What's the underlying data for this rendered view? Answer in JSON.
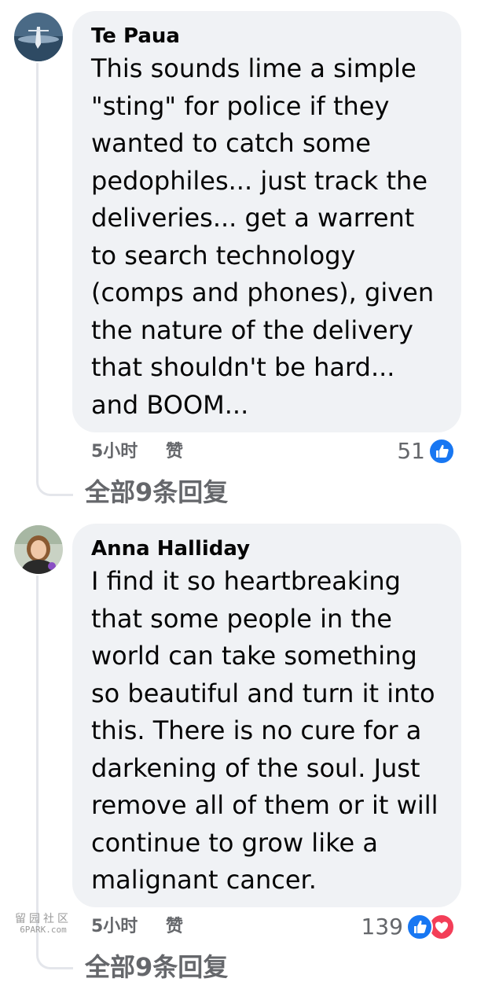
{
  "comments": [
    {
      "author": "Te Paua",
      "text": "This sounds lime a simple \"sting\" for police if they wanted to catch some pedophiles... just track the deliveries... get a warrent to search technology (comps and phones), given the nature of the delivery that shouldn't be hard... and BOOM...",
      "time": "5小时",
      "like_label": "赞",
      "reaction_count": "51",
      "reaction_icons": [
        "like-icon"
      ],
      "replies_label": "全部9条回复"
    },
    {
      "author": "Anna Halliday",
      "text": "I find it so heartbreaking that some people in the world can take something so beautiful and turn it into this. There is no cure for a darkening of the soul. Just remove all of them or it will continue to grow like a malignant cancer.",
      "time": "5小时",
      "like_label": "赞",
      "reaction_count": "139",
      "reaction_icons": [
        "like-icon",
        "love-icon"
      ],
      "replies_label": "全部9条回复"
    }
  ],
  "watermark": {
    "top": "留园社区",
    "bottom": "6PARK.com"
  },
  "colors": {
    "bubble": "#f0f2f5",
    "meta_text": "#65676b",
    "like_blue": "#1877f2",
    "love_red": "#f33e58"
  }
}
